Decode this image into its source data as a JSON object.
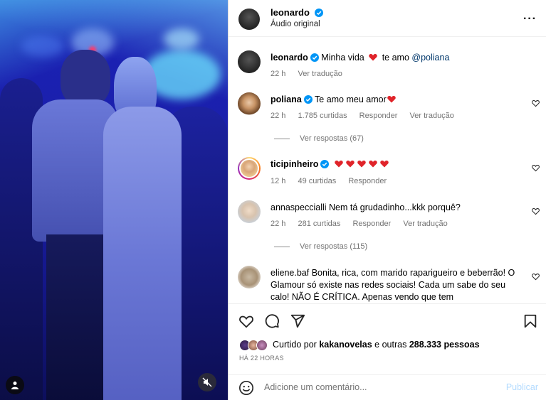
{
  "post": {
    "author": "leonardo",
    "subtitle": "Áudio original"
  },
  "comments": [
    {
      "user": "leonardo",
      "verified": true,
      "text_pre": "Minha vida",
      "text_post": "te amo",
      "mention": "@poliana",
      "time": "22 h",
      "actions": [
        "Ver tradução"
      ]
    },
    {
      "user": "poliana",
      "verified": true,
      "text": "Te amo meu amor",
      "time": "22 h",
      "likes": "1.785 curtidas",
      "actions": [
        "Responder",
        "Ver tradução"
      ],
      "replies": "Ver respostas (67)"
    },
    {
      "user": "ticipinheiro",
      "verified": true,
      "time": "12 h",
      "likes": "49 curtidas",
      "actions": [
        "Responder"
      ]
    },
    {
      "user": "annaspeccialli",
      "text": "Nem tá grudadinho...kkk porquê?",
      "time": "22 h",
      "likes": "281 curtidas",
      "actions": [
        "Responder",
        "Ver tradução"
      ],
      "replies": "Ver respostas (115)"
    },
    {
      "user": "eliene.baf",
      "text": "Bonita, rica, com marido raparigueiro e beberrão! O Glamour só existe nas redes sociais! Cada um sabe do seu calo! NÃO É CRÍTICA. Apenas vendo que tem"
    }
  ],
  "likes": {
    "prefix": "Curtido por",
    "user": "kakanovelas",
    "suffix": "e outras",
    "count": "288.333 pessoas"
  },
  "time_ago": "HÁ 22 HORAS",
  "add_comment": {
    "placeholder": "Adicione um comentário...",
    "publish": "Publicar"
  },
  "colors": {
    "verified": "#0095f6",
    "heart_red": "#e0242a",
    "publish_disabled": "#b3dbff",
    "video_blue": "#1b1fa8"
  },
  "icons": [
    "heart-icon",
    "comment-icon",
    "share-icon",
    "bookmark-icon",
    "more-icon",
    "emoji-icon",
    "user-icon",
    "mute-icon"
  ]
}
